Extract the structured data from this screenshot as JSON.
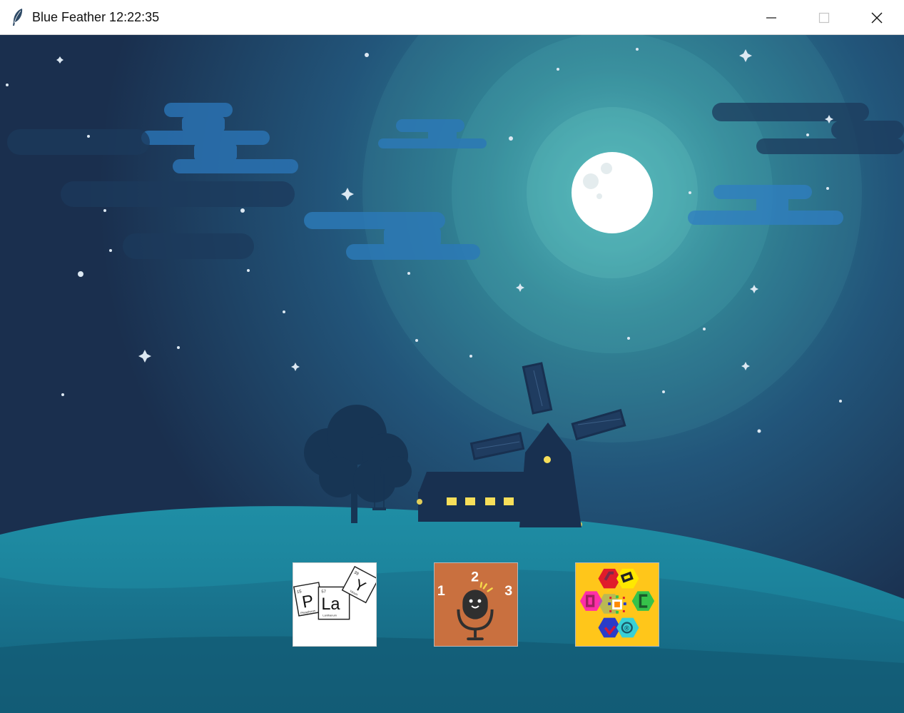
{
  "window": {
    "title": "Blue Feather 12:22:35",
    "icon": "feather-icon",
    "controls": [
      "minimize-icon",
      "maximize-icon",
      "close-icon"
    ]
  },
  "launcher": {
    "apps": [
      {
        "name": "periodic-play",
        "icon": "periodic-play-icon",
        "tiles": [
          {
            "number": "15",
            "symbol": "P",
            "element": "Phosphorus"
          },
          {
            "number": "57",
            "symbol": "La",
            "element": "Lanthanum"
          },
          {
            "number": "39",
            "symbol": "Y",
            "element": "Yttrium"
          }
        ]
      },
      {
        "name": "counting-microphone",
        "icon": "microphone-icon",
        "numbers": [
          "1",
          "2",
          "3"
        ]
      },
      {
        "name": "hexagon-puzzle",
        "icon": "hexagon-puzzle-icon",
        "glyphs": [
          "®"
        ]
      }
    ]
  },
  "colors": {
    "sky_dark": "#1b3452",
    "sky_glow": "#3f9fa8",
    "moon": "#ffffff",
    "hill": "#1b7f98",
    "silhouette": "#183050",
    "window_light": "#f7df5a"
  }
}
